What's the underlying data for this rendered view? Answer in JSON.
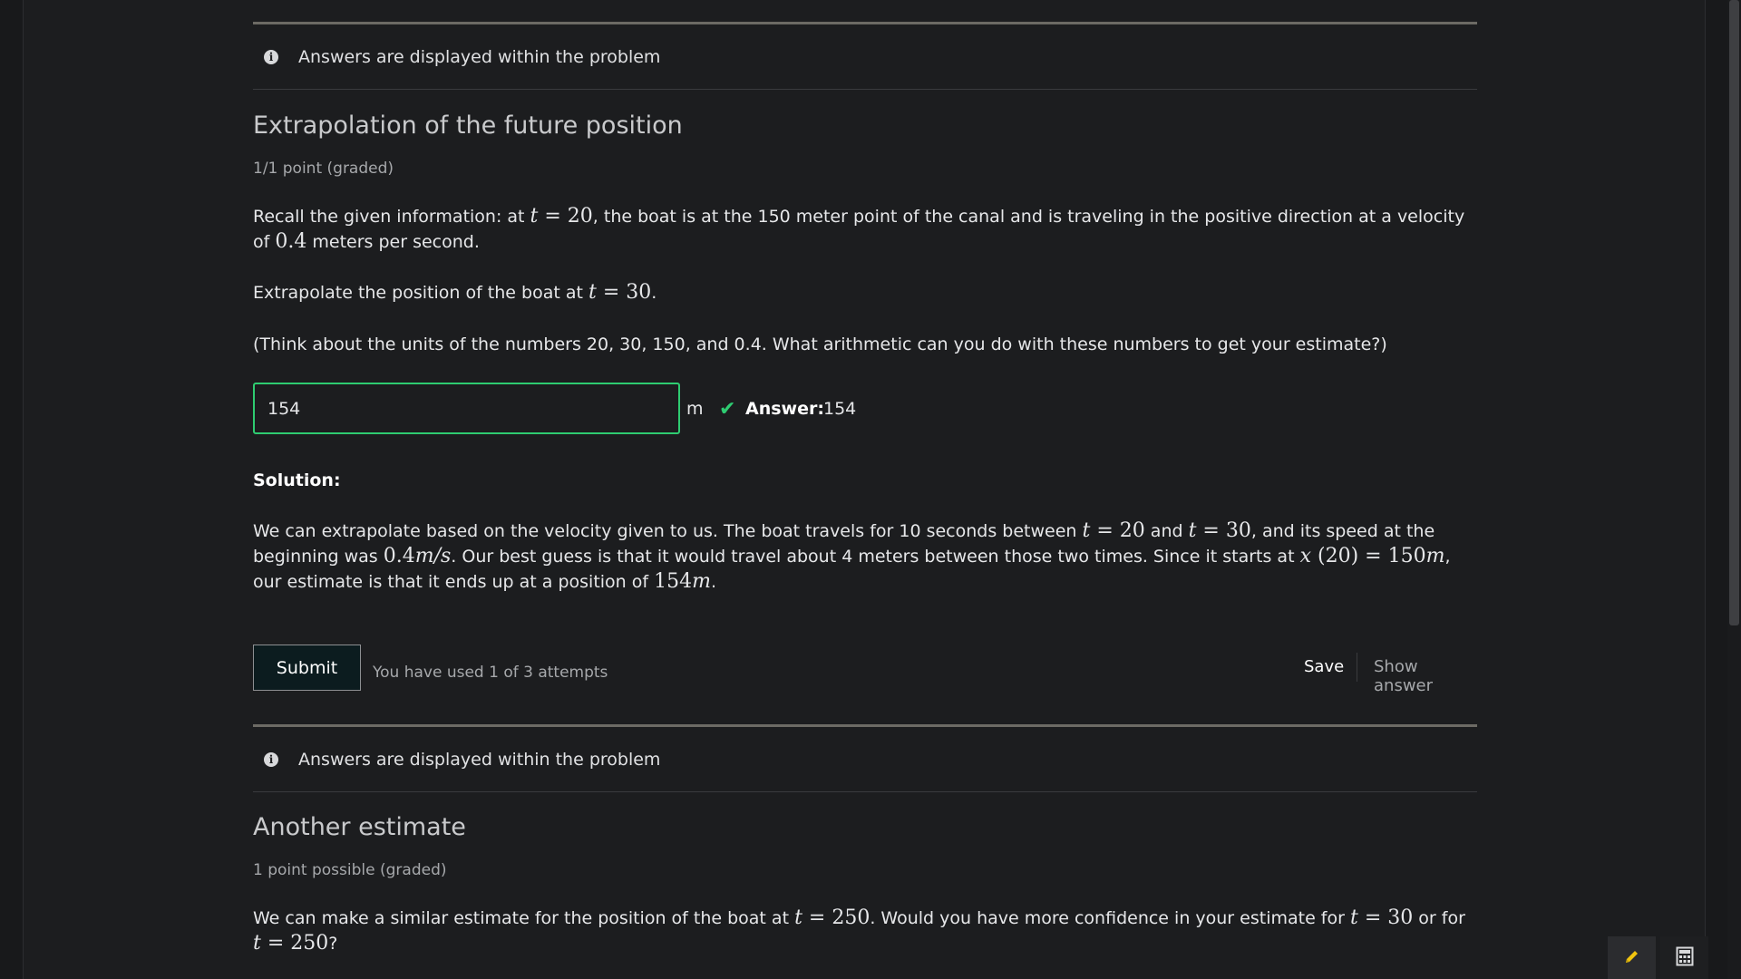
{
  "notices": [
    "Answers are displayed within the problem",
    "Answers are displayed within the problem"
  ],
  "problem1": {
    "title": "Extrapolation of the future position",
    "points": "1/1 point (graded)",
    "p1_a": "Recall the given information: at ",
    "p1_t": "t",
    "p1_eq": " = 20",
    "p1_b": ", the boat is at the 150 meter point of the canal and is traveling in the positive direction at a velocity of ",
    "p1_v": "0.4",
    "p1_c": " meters per second.",
    "p2_a": "Extrapolate the position of the boat at ",
    "p2_t": "t",
    "p2_eq": " = 30",
    "p2_b": ".",
    "p3": "(Think about the units of the numbers 20, 30, 150, and 0.4. What arithmetic can you do with these numbers to get your estimate?)",
    "input_value": "154",
    "unit": "m",
    "answer_label": "Answer:",
    "answer_value": "154",
    "solution_label": "Solution:",
    "sol_a": "We can extrapolate based on the velocity given to us. The boat travels for 10 seconds between ",
    "sol_t1": "t",
    "sol_eq1": " = 20",
    "sol_b": " and ",
    "sol_t2": "t",
    "sol_eq2": " = 30",
    "sol_c": ", and its speed at the beginning was ",
    "sol_v": "0.4",
    "sol_vu": "m/s",
    "sol_d": ". Our best guess is that it would travel about 4 meters between those two times. Since it starts at ",
    "sol_x": "x",
    "sol_x20": " (20) = 150",
    "sol_m1": "m",
    "sol_e": ", our estimate is that it ends up at a position of ",
    "sol_154": "154",
    "sol_m2": "m",
    "sol_f": ".",
    "submit_label": "Submit",
    "attempts": "You have used 1 of 3 attempts",
    "save_label": "Save",
    "show_answer_label": "Show answer"
  },
  "problem2": {
    "title": "Another estimate",
    "points": "1 point possible (graded)",
    "p1_a": "We can make a similar estimate for the position of the boat at ",
    "p1_t1": "t",
    "p1_eq1": " = 250",
    "p1_b": ". Would you have more confidence in your estimate for ",
    "p1_t2": "t",
    "p1_eq2": " = 30",
    "p1_c": " or for ",
    "p1_t3": "t",
    "p1_eq3": " = 250",
    "p1_d": "?"
  },
  "tools": {
    "pencil_icon": "pencil-icon",
    "calculator_icon": "calculator-icon"
  },
  "colors": {
    "background": "#1c1d1f",
    "correct": "#2ecc71",
    "pencil": "#f1c40f"
  }
}
